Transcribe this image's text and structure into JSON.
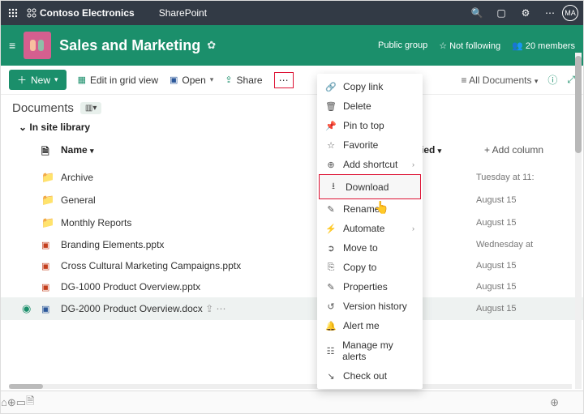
{
  "topbar": {
    "brand": "Contoso Electronics",
    "app": "SharePoint",
    "avatar": "MA"
  },
  "site": {
    "title": "Sales and Marketing",
    "group": "Public group",
    "follow": "Not following",
    "members": "20 members"
  },
  "cmd": {
    "new": "New",
    "editGrid": "Edit in grid view",
    "open": "Open",
    "share": "Share",
    "allDocs": "All Documents"
  },
  "page": {
    "title": "Documents",
    "breadcrumb": "In site library"
  },
  "cols": {
    "name": "Name",
    "modified": "Modified",
    "add": "+  Add column"
  },
  "rows": [
    {
      "type": "folder",
      "name": "Archive",
      "modified": "Tuesday at 11:"
    },
    {
      "type": "folder",
      "name": "General",
      "modified": "August 15"
    },
    {
      "type": "folder",
      "name": "Monthly Reports",
      "modified": "August 15"
    },
    {
      "type": "pptx",
      "name": "Branding Elements.pptx",
      "modified": "Wednesday at"
    },
    {
      "type": "pptx",
      "name": "Cross Cultural Marketing Campaigns.pptx",
      "modified": "August 15"
    },
    {
      "type": "pptx",
      "name": "DG-1000 Product Overview.pptx",
      "modified": "August 15"
    },
    {
      "type": "docx",
      "name": "DG-2000 Product Overview.docx",
      "modified": "August 15",
      "selected": true
    }
  ],
  "menu": {
    "copyLink": "Copy link",
    "delete": "Delete",
    "pin": "Pin to top",
    "favorite": "Favorite",
    "shortcut": "Add shortcut",
    "download": "Download",
    "rename": "Rename",
    "automate": "Automate",
    "moveTo": "Move to",
    "copyTo": "Copy to",
    "properties": "Properties",
    "version": "Version history",
    "alert": "Alert me",
    "manageAlerts": "Manage my alerts",
    "checkOut": "Check out"
  }
}
